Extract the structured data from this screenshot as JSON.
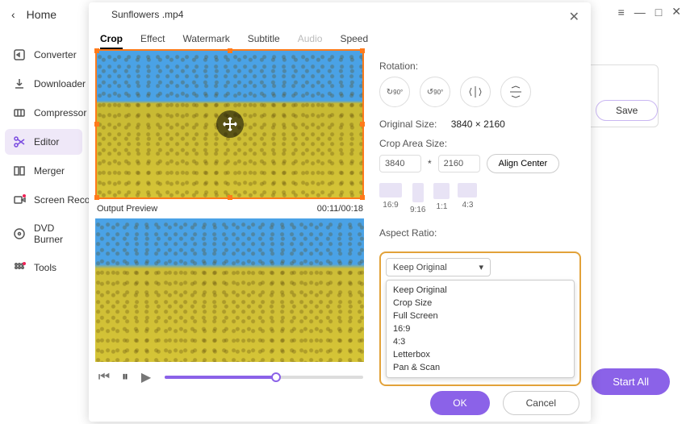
{
  "sys": {
    "hamburger": "≡",
    "min": "—",
    "max": "□",
    "close": "✕"
  },
  "home": "Home",
  "nav": {
    "items": [
      {
        "label": "Converter"
      },
      {
        "label": "Downloader"
      },
      {
        "label": "Compressor"
      },
      {
        "label": "Editor"
      },
      {
        "label": "Merger"
      },
      {
        "label": "Screen Recorder"
      },
      {
        "label": "DVD Burner"
      },
      {
        "label": "Tools"
      }
    ]
  },
  "right": {
    "save": "Save",
    "start_all": "Start All"
  },
  "modal": {
    "title": "Sunflowers .mp4",
    "tabs": {
      "crop": "Crop",
      "effect": "Effect",
      "watermark": "Watermark",
      "subtitle": "Subtitle",
      "audio": "Audio",
      "speed": "Speed"
    },
    "preview_label": "Output Preview",
    "time": "00:11/00:18",
    "rotation_label": "Rotation:",
    "rot90a": "90°",
    "rot90b": "90°",
    "original_size_label": "Original Size:",
    "original_size": "3840 × 2160",
    "crop_size_label": "Crop Area Size:",
    "crop_w": "3840",
    "crop_h": "2160",
    "mult": "*",
    "align_center": "Align Center",
    "ar_thumbs": {
      "a": "16:9",
      "b": "9:16",
      "c": "1:1",
      "d": "4:3"
    },
    "aspect_label": "Aspect Ratio:",
    "aspect_selected": "Keep Original",
    "aspect_options": [
      "Keep Original",
      "Crop Size",
      "Full Screen",
      "16:9",
      "4:3",
      "Letterbox",
      "Pan & Scan"
    ],
    "ok": "OK",
    "cancel": "Cancel"
  }
}
